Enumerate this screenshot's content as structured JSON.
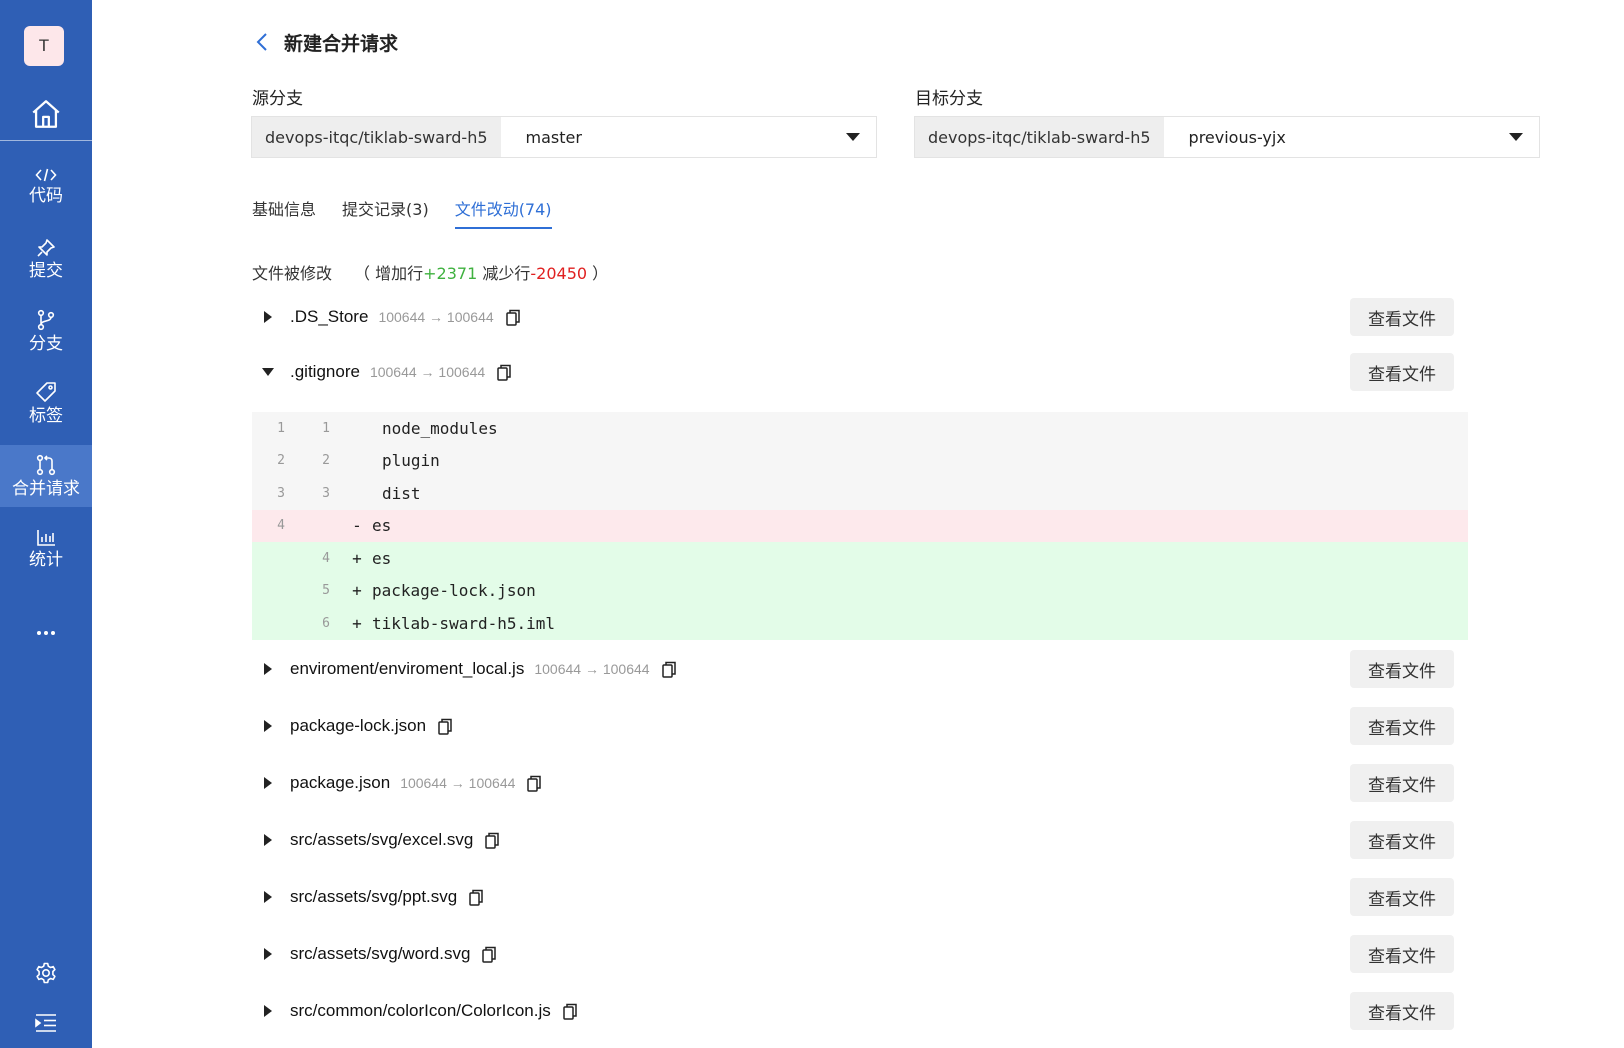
{
  "sidebar": {
    "avatar": "T",
    "items": [
      {
        "label": "代码",
        "icon": "code-icon"
      },
      {
        "label": "提交",
        "icon": "pin-icon"
      },
      {
        "label": "分支",
        "icon": "branch-icon"
      },
      {
        "label": "标签",
        "icon": "tag-icon"
      },
      {
        "label": "合并请求",
        "icon": "merge-request-icon",
        "active": true
      },
      {
        "label": "统计",
        "icon": "bar-chart-icon"
      }
    ]
  },
  "header": {
    "title": "新建合并请求"
  },
  "source": {
    "label": "源分支",
    "repo": "devops-itqc/tiklab-sward-h5",
    "branch": "master"
  },
  "target": {
    "label": "目标分支",
    "repo": "devops-itqc/tiklab-sward-h5",
    "branch": "previous-yjx"
  },
  "tabs": [
    "基础信息",
    "提交记录(3)",
    "文件改动(74)"
  ],
  "summary": {
    "prefix": "文件被修改",
    "open": "（",
    "added_label": "增加行",
    "added": "+2371",
    "removed_label": "减少行",
    "removed": "-20450",
    "close": "）"
  },
  "view_label": "查看文件",
  "files": [
    {
      "name": ".DS_Store",
      "mode": "100644 → 100644"
    },
    {
      "name": ".gitignore",
      "mode": "100644 → 100644"
    },
    {
      "name": "enviroment/enviroment_local.js",
      "mode": "100644 → 100644"
    },
    {
      "name": "package-lock.json",
      "mode": ""
    },
    {
      "name": "package.json",
      "mode": "100644 → 100644"
    },
    {
      "name": "src/assets/svg/excel.svg",
      "mode": ""
    },
    {
      "name": "src/assets/svg/ppt.svg",
      "mode": ""
    },
    {
      "name": "src/assets/svg/word.svg",
      "mode": ""
    },
    {
      "name": "src/common/colorIcon/ColorIcon.js",
      "mode": ""
    }
  ],
  "diff": [
    {
      "type": "ctx",
      "old": "1",
      "new": "1",
      "sign": "",
      "code": "node_modules"
    },
    {
      "type": "ctx",
      "old": "2",
      "new": "2",
      "sign": "",
      "code": "plugin"
    },
    {
      "type": "ctx",
      "old": "3",
      "new": "3",
      "sign": "",
      "code": "dist"
    },
    {
      "type": "del",
      "old": "4",
      "new": "",
      "sign": "-",
      "code": "es"
    },
    {
      "type": "add",
      "old": "",
      "new": "4",
      "sign": "+",
      "code": "es"
    },
    {
      "type": "add",
      "old": "",
      "new": "5",
      "sign": "+",
      "code": "package-lock.json"
    },
    {
      "type": "add",
      "old": "",
      "new": "6",
      "sign": "+",
      "code": "tiklab-sward-h5.iml"
    }
  ]
}
